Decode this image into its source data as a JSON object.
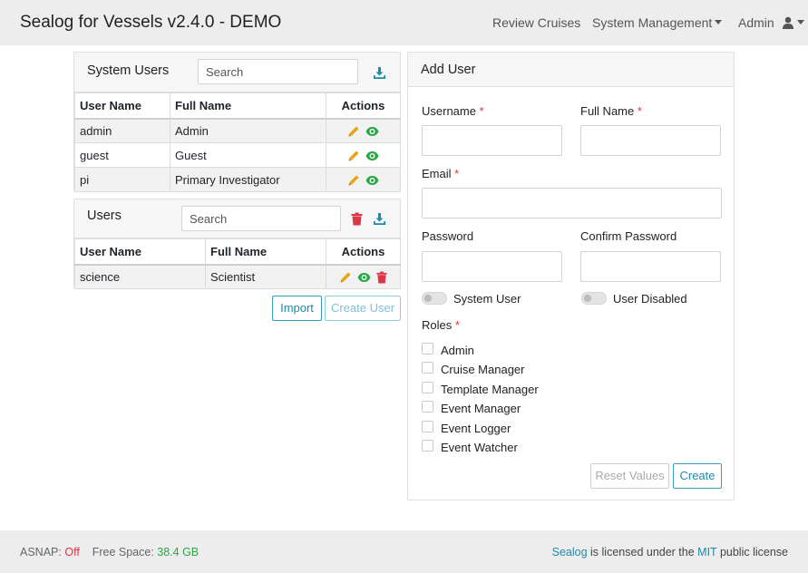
{
  "header": {
    "brand": "Sealog for Vessels v2.4.0 - DEMO",
    "nav": {
      "review_cruises": "Review Cruises",
      "system_management": "System Management",
      "admin": "Admin"
    }
  },
  "system_users": {
    "title": "System Users",
    "search_placeholder": "Search",
    "columns": [
      "User Name",
      "Full Name",
      "Actions"
    ],
    "rows": [
      {
        "username": "admin",
        "fullname": "Admin"
      },
      {
        "username": "guest",
        "fullname": "Guest"
      },
      {
        "username": "pi",
        "fullname": "Primary Investigator"
      }
    ]
  },
  "users": {
    "title": "Users",
    "search_placeholder": "Search",
    "columns": [
      "User Name",
      "Full Name",
      "Actions"
    ],
    "rows": [
      {
        "username": "science",
        "fullname": "Scientist"
      }
    ],
    "import_label": "Import",
    "create_user_label": "Create User"
  },
  "add_user": {
    "title": "Add User",
    "username_label": "Username",
    "fullname_label": "Full Name",
    "email_label": "Email",
    "password_label": "Password",
    "confirm_password_label": "Confirm Password",
    "required_mark": "*",
    "system_user_label": "System User",
    "user_disabled_label": "User Disabled",
    "roles_label": "Roles",
    "roles": [
      "Admin",
      "Cruise Manager",
      "Template Manager",
      "Event Manager",
      "Event Logger",
      "Event Watcher"
    ],
    "reset_label": "Reset Values",
    "create_label": "Create",
    "username_value": "",
    "fullname_value": "",
    "email_value": "",
    "password_value": "",
    "confirm_password_value": ""
  },
  "footer": {
    "asnap_label": "ASNAP:",
    "asnap_value": "Off",
    "free_space_label": "Free Space:",
    "free_space_value": "38.4 GB",
    "sealog_link": "Sealog",
    "license_text_1": "is licensed under the",
    "mit_link": "MIT",
    "license_text_2": "public license"
  },
  "colors": {
    "accent": "#1f8aa8",
    "edit_icon": "#e8a317",
    "view_icon": "#28a745",
    "delete_icon": "#dc3545",
    "required": "#dc3545"
  },
  "icons": {
    "download": "download-icon",
    "edit": "pencil-icon",
    "view": "eye-icon",
    "delete": "trash-icon",
    "user": "user-icon"
  }
}
